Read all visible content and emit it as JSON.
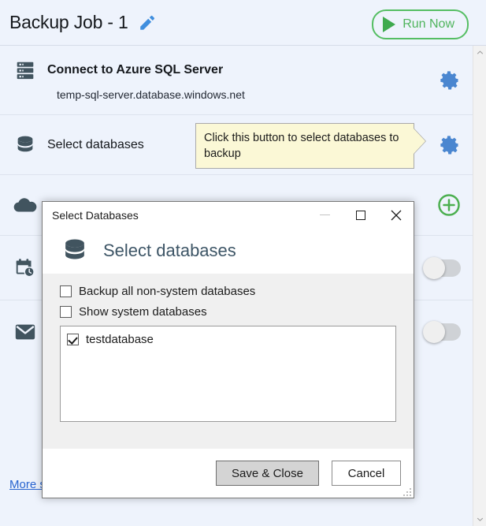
{
  "header": {
    "job_title": "Backup Job - 1",
    "edit_icon": "pencil-icon",
    "run_now_label": "Run Now",
    "run_now_color": "#4fb45c"
  },
  "steps": [
    {
      "icon": "server-icon",
      "title": "Connect to Azure SQL Server",
      "subtitle": "temp-sql-server.database.windows.net",
      "action": "gear-icon"
    },
    {
      "icon": "database-icon",
      "title": "Select databases",
      "action": "gear-icon",
      "callout": "Click this button to select databases to backup"
    },
    {
      "icon": "cloud-icon",
      "title": "",
      "action": "plus-circle-icon"
    },
    {
      "icon": "calendar-clock-icon",
      "title": "",
      "action": "toggle-switch-off"
    },
    {
      "icon": "envelope-icon",
      "title": "",
      "action": "toggle-switch-off"
    }
  ],
  "more_settings_link": "More s",
  "scrollbar": {
    "up_arrow": "chevron-up-icon",
    "down_arrow": "chevron-down-icon"
  },
  "dialog": {
    "titlebar": {
      "title": "Select Databases",
      "minimize": "minimize-icon",
      "maximize": "maximize-icon",
      "close": "close-icon"
    },
    "header_title": "Select databases",
    "header_icon": "database-icon",
    "checkboxes": [
      {
        "label": "Backup all non-system databases",
        "checked": false
      },
      {
        "label": "Show system databases",
        "checked": false
      }
    ],
    "database_list": [
      {
        "name": "testdatabase",
        "checked": true
      }
    ],
    "buttons": {
      "save": "Save & Close",
      "cancel": "Cancel"
    }
  },
  "colors": {
    "app_background": "#eef3fc",
    "icon_slate": "#41545f",
    "gear_blue": "#4a86d0",
    "accent_green": "#4fb45c",
    "link_blue": "#2763cf",
    "callout_yellow": "#fbf8d6"
  }
}
